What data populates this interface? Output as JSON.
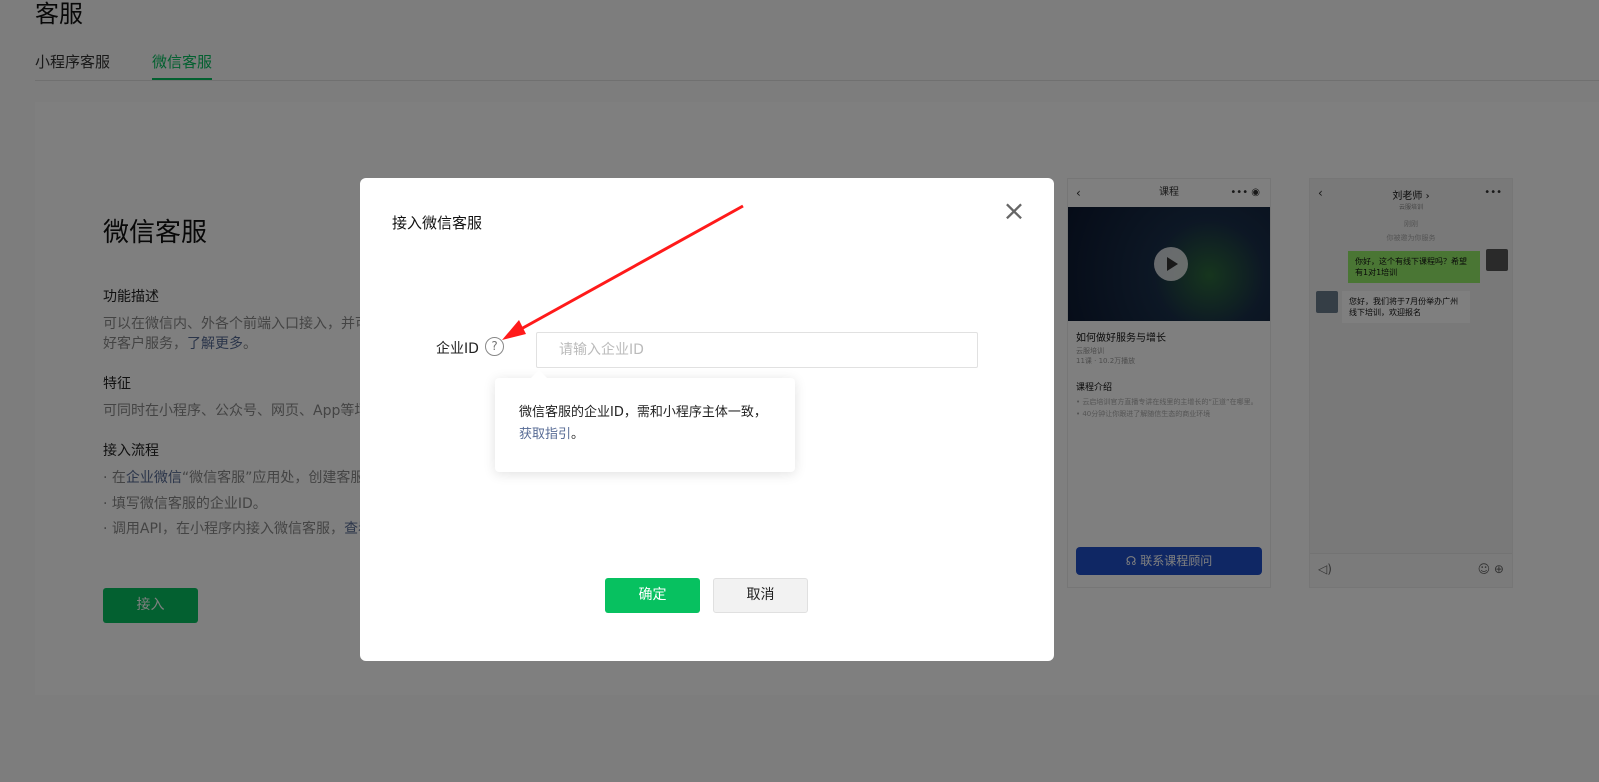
{
  "page": {
    "title": "客服",
    "tabs": [
      "小程序客服",
      "微信客服"
    ],
    "active_tab": "微信客服"
  },
  "card": {
    "title": "微信客服",
    "desc_label": "功能描述",
    "desc_text_1": "可以在微信内、外各个前端入口接入，并可",
    "desc_text_2": "好客户服务，",
    "desc_link": "了解更多",
    "desc_end": "。",
    "feature_label": "特征",
    "feature_text": "可同时在小程序、公众号、网页、App等场",
    "flow_label": "接入流程",
    "flow_1_pre": "· 在",
    "flow_1_link": "企业微信",
    "flow_1_post": "“微信客服”应用处，创建客服",
    "flow_2": "· 填写微信客服的企业ID。",
    "flow_3_pre": "· 调用API，在小程序内接入微信客服，",
    "flow_3_link": "查看",
    "connect_button": "接入"
  },
  "preview_course": {
    "header": "课程",
    "course_title": "如何做好服务与增长",
    "course_sub": "云服培训",
    "course_meta": "11课 · 10.2万播放",
    "intro_title": "课程介绍",
    "intro_1": "• 云启培训官方直播专讲在线里的主增长的“正道”在哪里。",
    "intro_2": "• 40分钟让你跟进了解随信生态的商业环境",
    "consult_button": "联系课程顾问"
  },
  "preview_chat": {
    "name": "刘老师 ›",
    "sub": "云服培训",
    "note_1": "刚刚",
    "note_2": "你被邀为你服务",
    "msg_right": "你好，这个有线下课程吗？希望有1对1培训",
    "msg_left": "您好，我们将于7月份举办广州线下培训，欢迎报名"
  },
  "modal": {
    "title": "接入微信客服",
    "field_label": "企业ID",
    "help_icon": "?",
    "input_placeholder": "请输入企业ID",
    "input_value": "",
    "tooltip_text": "微信客服的企业ID，需和小程序主体一致，",
    "tooltip_link": "获取指引",
    "tooltip_end": "。",
    "confirm_button": "确定",
    "cancel_button": "取消",
    "close_icon": "×"
  },
  "colors": {
    "accent": "#07c160",
    "link": "#576b95",
    "overlay": "rgba(0,0,0,0.5)",
    "annotation_arrow": "#ff1a1a"
  }
}
